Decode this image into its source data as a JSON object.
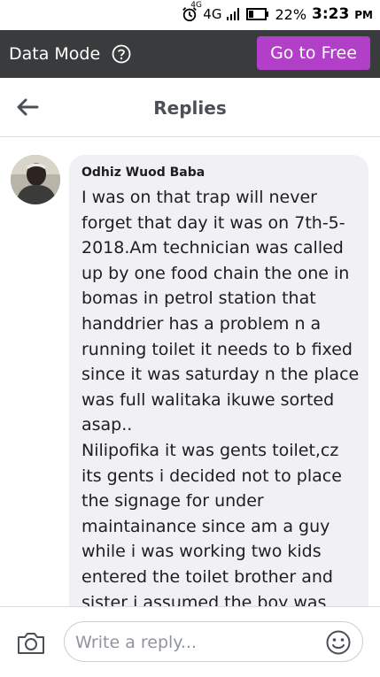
{
  "status_bar": {
    "network_sup": "4G",
    "network": "4G",
    "battery": "22%",
    "time": "3:23",
    "time_suffix": "PM"
  },
  "data_mode": {
    "label": "Data Mode",
    "cta_label": "Go to Free",
    "cta_color": "#b13fc7"
  },
  "header": {
    "title": "Replies"
  },
  "comment": {
    "author": "Odhiz Wuod Baba",
    "text": "I was on that trap will never forget that day it was on 7th-5-2018.Am technician was called up by one food chain the one in bomas  in  petrol station that handdrier has a problem n a running toilet it needs to b fixed since it was saturday n the place was full walitaka ikuwe sorted asap..\nNilipofika it was gents toilet,cz its gents i decided not to place the signage for under maintainance since am a guy while i was working two kids entered the toilet brother and sister i assumed the boy was"
  },
  "footer": {
    "reply_placeholder": "Write a reply..."
  },
  "icons": {
    "alarm": "alarm-icon",
    "signal": "signal-icon",
    "battery": "battery-icon",
    "help": "help-icon",
    "back": "back-arrow-icon",
    "camera": "camera-icon",
    "emoji": "emoji-icon"
  }
}
